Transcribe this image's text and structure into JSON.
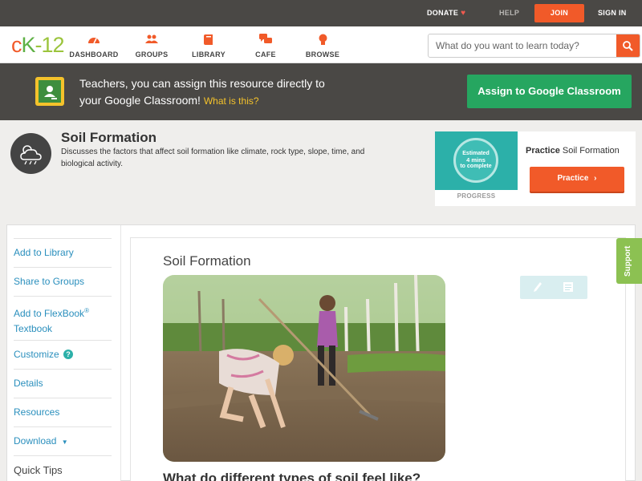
{
  "topbar": {
    "donate": "DONATE",
    "help": "HELP",
    "join": "JOIN",
    "sign_in": "SIGN IN",
    "bg_color": "#4a4845",
    "accent": "#f15a29"
  },
  "nav": {
    "logo_parts": [
      "c",
      "K",
      "-12"
    ],
    "items": [
      {
        "label": "DASHBOARD",
        "icon": "gauge-icon"
      },
      {
        "label": "GROUPS",
        "icon": "people-icon"
      },
      {
        "label": "LIBRARY",
        "icon": "book-icon"
      },
      {
        "label": "CAFE",
        "icon": "chat-icon"
      },
      {
        "label": "BROWSE",
        "icon": "lightbulb-icon"
      }
    ],
    "search_placeholder": "What do you want to learn today?"
  },
  "banner": {
    "text_line1": "Teachers, you can assign this resource directly to",
    "text_line2": "your Google Classroom!",
    "what_link": "What is this?",
    "assign_button": "Assign to Google Classroom",
    "button_color": "#26a660"
  },
  "concept": {
    "title": "Soil Formation",
    "description": "Discusses the factors that affect soil formation like climate, rock type, slope, time, and biological activity.",
    "icon": "weather-cloud-icon"
  },
  "practice_card": {
    "estimated_line1": "Estimated",
    "estimated_line2": "4 mins",
    "estimated_line3": "to complete",
    "progress_label": "PROGRESS",
    "heading_bold": "Practice",
    "heading_rest": "Soil Formation",
    "button": "Practice"
  },
  "sidebar": {
    "add_library": "Add to Library",
    "share_groups": "Share to Groups",
    "add_flexbook_1": "Add to FlexBook",
    "add_flexbook_reg": "®",
    "add_flexbook_2": "Textbook",
    "customize": "Customize",
    "details": "Details",
    "resources": "Resources",
    "download": "Download",
    "quick_tips": "Quick Tips"
  },
  "article": {
    "title": "Soil Formation",
    "image_alt": "Two children digging soil in a garden with a rake",
    "subheading": "What do different types of soil feel like?"
  },
  "support_tab": "Support"
}
